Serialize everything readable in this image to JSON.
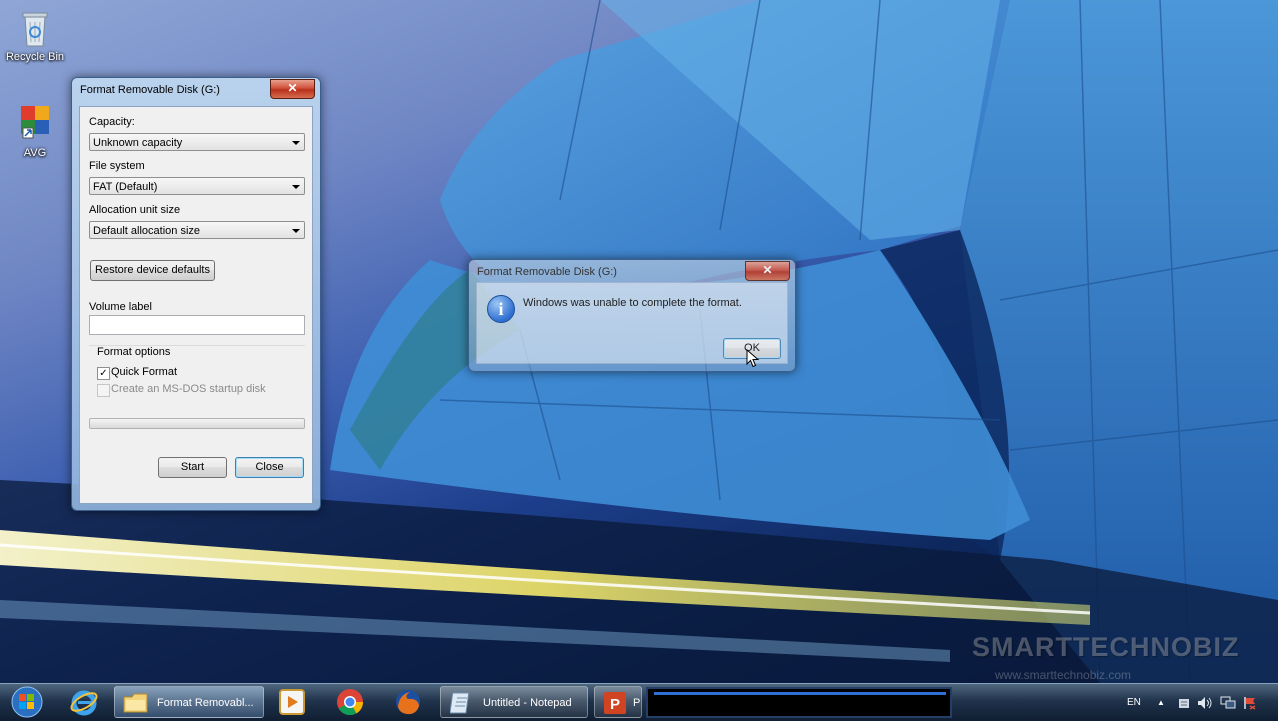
{
  "desktop": {
    "icons": [
      {
        "label": "Recycle Bin"
      },
      {
        "label": "AVG"
      }
    ],
    "watermark": {
      "brand": "SMARTTECHNOBIZ",
      "url": "www.smarttechnobiz.com"
    }
  },
  "format_dialog": {
    "title": "Format Removable Disk (G:)",
    "close_glyph": "✕",
    "capacity_label": "Capacity:",
    "capacity_value": "Unknown capacity",
    "filesystem_label": "File system",
    "filesystem_value": "FAT (Default)",
    "allocation_label": "Allocation unit size",
    "allocation_value": "Default allocation size",
    "restore_button": "Restore device defaults",
    "volume_label": "Volume label",
    "volume_value": "",
    "format_options_label": "Format options",
    "quick_format_label": "Quick Format",
    "quick_format_checked": true,
    "msdos_label": "Create an MS-DOS startup disk",
    "msdos_checked": false,
    "progress": 0,
    "start_button": "Start",
    "close_button": "Close"
  },
  "message_box": {
    "title": "Format Removable Disk (G:)",
    "close_glyph": "✕",
    "icon_glyph": "i",
    "message": "Windows was unable to complete the format.",
    "ok_button": "OK"
  },
  "taskbar": {
    "items": [
      {
        "label": "Format Removabl..."
      },
      {
        "label": "Untitled - Notepad"
      },
      {
        "label": "P"
      }
    ],
    "tray": {
      "language": "EN",
      "show_hidden_glyph": "▲"
    }
  },
  "colors": {
    "close_button_red": "#c8412a",
    "taskbar": "#1a2d45",
    "info_icon_blue": "#2f6fd0"
  }
}
